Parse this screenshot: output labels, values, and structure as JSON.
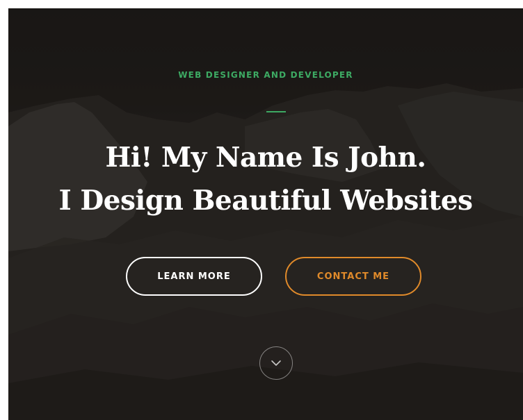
{
  "hero": {
    "eyebrow": "WEB DESIGNER AND DEVELOPER",
    "headline_line1": "Hi! My Name Is John.",
    "headline_line2": "I Design Beautiful Websites"
  },
  "buttons": {
    "learn_more": "LEARN MORE",
    "contact_me": "CONTACT ME"
  },
  "icons": {
    "scroll": "chevron-down-icon"
  },
  "colors": {
    "accent_green": "#3daa63",
    "accent_orange": "#e08a2a",
    "text_white": "#ffffff",
    "background_dark": "#262320"
  }
}
